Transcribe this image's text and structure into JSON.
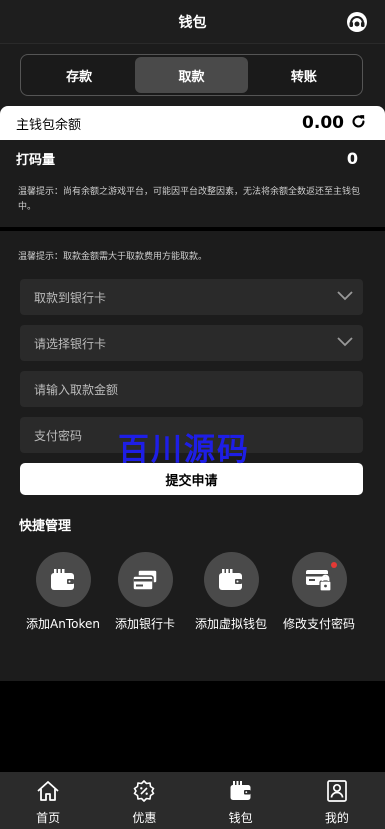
{
  "header": {
    "title": "钱包",
    "support_icon": "headset-support-icon"
  },
  "tabs": [
    {
      "label": "存款",
      "active": false
    },
    {
      "label": "取款",
      "active": true
    },
    {
      "label": "转账",
      "active": false
    }
  ],
  "balance": {
    "label": "主钱包余额",
    "value": "0.00",
    "refresh_icon": "refresh-icon"
  },
  "wager": {
    "label": "打码量",
    "value": "0"
  },
  "tips": {
    "balance_tip": "温馨提示：尚有余额之游戏平台，可能因平台改整因素，无法将余额全数返还至主钱包中。",
    "withdraw_tip": "温馨提示：取款金额需大于取款费用方能取款。"
  },
  "form": {
    "withdraw_method": "取款到银行卡",
    "select_card": "请选择银行卡",
    "amount_placeholder": "请输入取款金额",
    "password_placeholder": "支付密码",
    "submit_label": "提交申请"
  },
  "quick": {
    "title": "快捷管理",
    "items": [
      {
        "label": "添加AnToken",
        "icon": "wallet-icon"
      },
      {
        "label": "添加银行卡",
        "icon": "bank-card-icon"
      },
      {
        "label": "添加虚拟钱包",
        "icon": "wallet-icon"
      },
      {
        "label": "修改支付密码",
        "icon": "card-lock-icon"
      }
    ]
  },
  "watermark": "百川源码",
  "nav": [
    {
      "label": "首页",
      "icon": "home-icon"
    },
    {
      "label": "优惠",
      "icon": "discount-icon"
    },
    {
      "label": "钱包",
      "icon": "wallet-icon"
    },
    {
      "label": "我的",
      "icon": "user-icon"
    }
  ],
  "colors": {
    "background": "#000000",
    "panel": "#1c1c1c",
    "field": "#2a2a2a",
    "accent_red": "#e53935",
    "watermark": "#1e1ee6"
  }
}
